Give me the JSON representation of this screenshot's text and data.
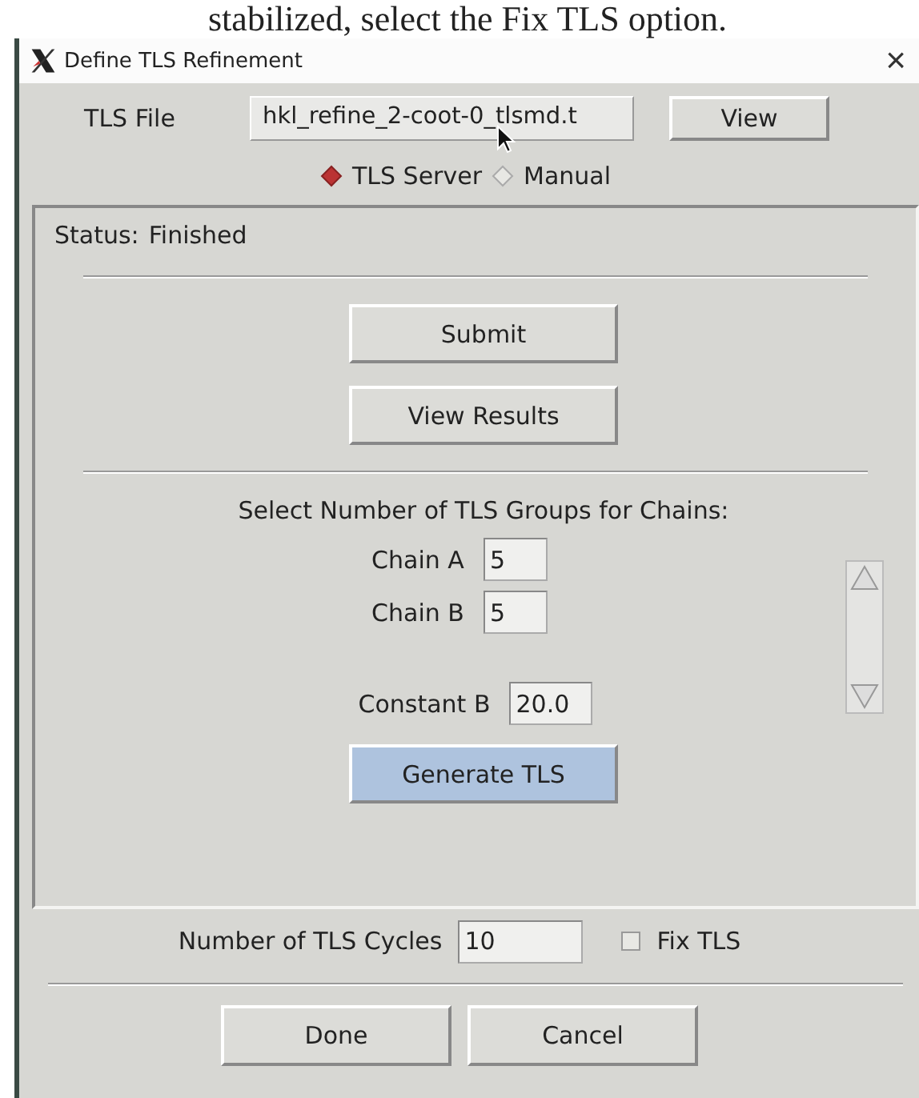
{
  "caption": "stabilized, select the Fix TLS option.",
  "window": {
    "title": "Define TLS Refinement",
    "close": "×"
  },
  "tls_file": {
    "label": "TLS File",
    "value": "hkl_refine_2-coot-0_tlsmd.t",
    "view_button": "View"
  },
  "source": [
    {
      "label": "TLS Server",
      "selected": true
    },
    {
      "label": "Manual",
      "selected": false
    }
  ],
  "status": {
    "label": "Status:",
    "value": "Finished"
  },
  "buttons": [
    "Submit",
    "View Results"
  ],
  "groups": {
    "title": "Select Number of TLS Groups for Chains:",
    "chains": [
      {
        "label": "Chain A",
        "value": "5"
      },
      {
        "label": "Chain B",
        "value": "5"
      }
    ]
  },
  "constant_b": {
    "label": "Constant B",
    "value": "20.0"
  },
  "generate_button": "Generate TLS",
  "cycles": {
    "label": "Number of TLS Cycles",
    "value": "10"
  },
  "fix_tls": {
    "label": "Fix TLS",
    "checked": false
  },
  "footer_buttons": [
    "Done",
    "Cancel"
  ]
}
